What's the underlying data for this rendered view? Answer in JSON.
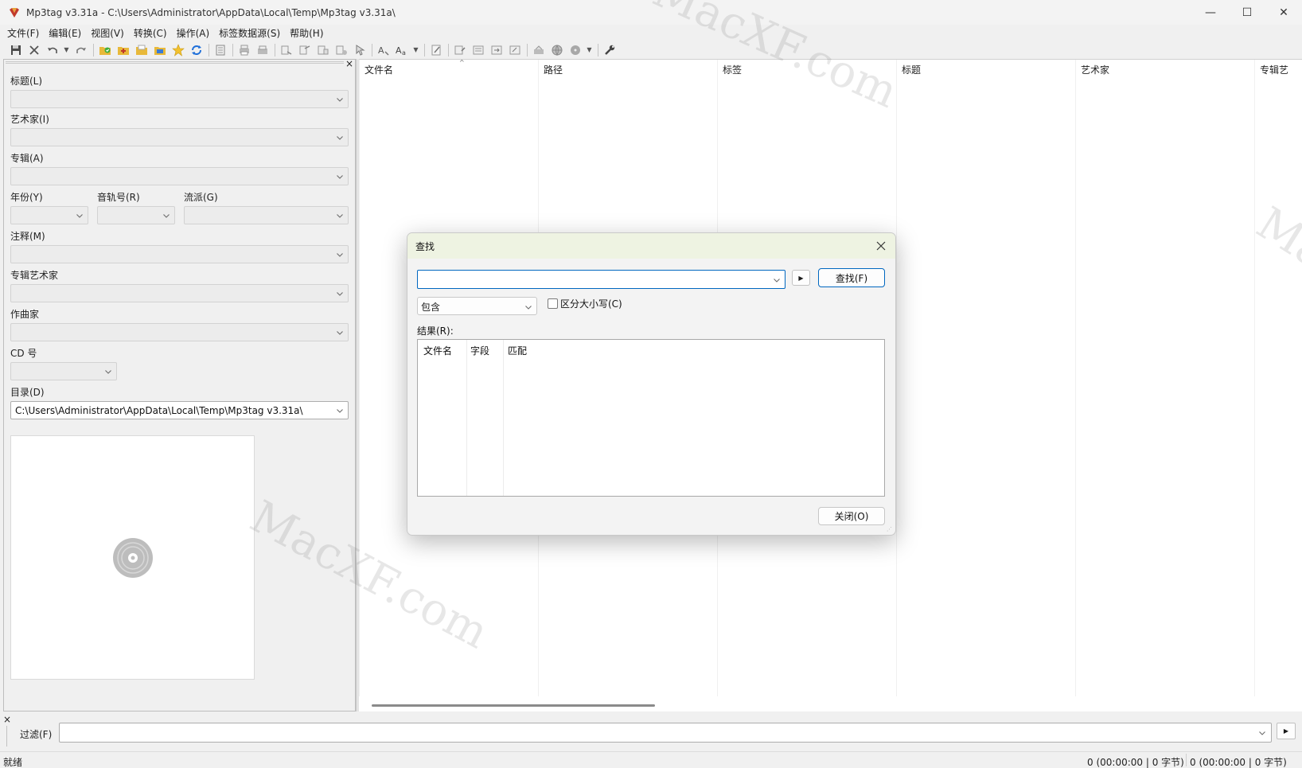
{
  "window": {
    "title": "Mp3tag v3.31a  -  C:\\Users\\Administrator\\AppData\\Local\\Temp\\Mp3tag v3.31a\\",
    "minimize": "—",
    "maximize": "☐",
    "close": "✕"
  },
  "menu": [
    {
      "label": "文件(F)"
    },
    {
      "label": "编辑(E)"
    },
    {
      "label": "视图(V)"
    },
    {
      "label": "转换(C)"
    },
    {
      "label": "操作(A)"
    },
    {
      "label": "标签数据源(S)"
    },
    {
      "label": "帮助(H)"
    }
  ],
  "toolbar": {
    "icons": [
      "save-icon",
      "remove-tag-icon",
      "undo-icon",
      "redo-icon",
      "change-dir-icon",
      "add-dir-icon",
      "open-folder-icon",
      "favorites-icon",
      "star-icon",
      "refresh-icon",
      "tag-panel-icon",
      "print-icon",
      "export-icon",
      "tag-to-filename-icon",
      "filename-to-tag-icon",
      "text-file-icon",
      "tag-to-tag-icon",
      "actions-icon",
      "case-icon",
      "edit-icon",
      "playlist-icon",
      "list-icon",
      "import-icon",
      "export-list-icon",
      "web-source-icon",
      "globe-icon",
      "disc-icon",
      "wrench-icon"
    ]
  },
  "tag_panel": {
    "title_label": "标题(L)",
    "artist_label": "艺术家(I)",
    "album_label": "专辑(A)",
    "year_label": "年份(Y)",
    "track_label": "音轨号(R)",
    "genre_label": "流派(G)",
    "comment_label": "注释(M)",
    "album_artist_label": "专辑艺术家",
    "composer_label": "作曲家",
    "disc_label": "CD 号",
    "directory_label": "目录(D)",
    "directory_value": "C:\\Users\\Administrator\\AppData\\Local\\Temp\\Mp3tag v3.31a\\",
    "close_glyph": "×"
  },
  "file_list": {
    "columns": [
      "文件名",
      "路径",
      "标签",
      "标题",
      "艺术家",
      "专辑艺"
    ],
    "sort_glyph": "^"
  },
  "filter": {
    "label": "过滤(F)",
    "close_glyph": "×",
    "go_glyph": "▶"
  },
  "status": {
    "text": "就绪",
    "selected": "0 (00:00:00 | 0 字节)",
    "total": "0 (00:00:00 | 0 字节)"
  },
  "find_dialog": {
    "title": "查找",
    "find_button": "查找(F)",
    "arrow_glyph": "▶",
    "mode_value": "包含",
    "case_label": "区分大小写(C)",
    "case_checked": false,
    "results_label": "结果(R):",
    "result_columns": [
      "文件名",
      "字段",
      "匹配"
    ],
    "close_button": "关闭(O)"
  },
  "watermark": {
    "text": "MacXF.com"
  },
  "colors": {
    "accent": "#0067c0",
    "dialog_title_bg": "#eef3e2"
  }
}
